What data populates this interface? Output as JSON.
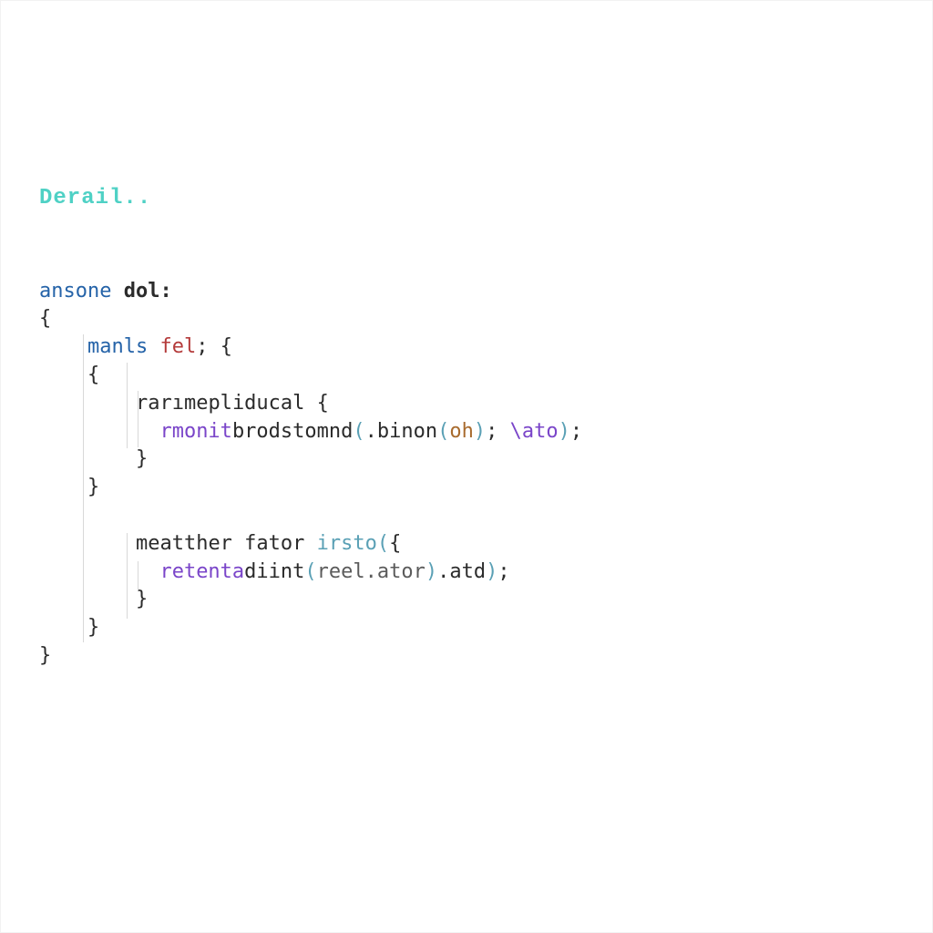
{
  "title": "Derail..",
  "code": {
    "l1_kw": "ansone",
    "l1_rest": " dol:",
    "l2": "{",
    "l3_kw": "manls",
    "l3_fn": " fel",
    "l3_rest": "; {",
    "l4": "{",
    "l5_a": "rarımepl",
    "l5_b": "iducal {",
    "l6_fn": "rmonit",
    "l6_b": "brodstomnd",
    "l6_p1": "(",
    "l6_c": ".binon",
    "l6_p2": "(",
    "l6_d": "oh",
    "l6_p3": ")",
    "l6_e": "; ",
    "l6_f": "\\ato",
    "l6_p4": ")",
    "l6_g": ";",
    "l7": "}",
    "l8": "}",
    "l9_a": "meatther fator ",
    "l9_b": "irsto",
    "l9_p1": "(",
    "l9_c": "{",
    "l10_fn": "retenta",
    "l10_b": "diint",
    "l10_p1": "(",
    "l10_c": "reel.ator",
    "l10_p2": ")",
    "l10_d": ".atd",
    "l10_p3": ")",
    "l10_e": ";",
    "l11": "}",
    "l12": "}",
    "l13": "}"
  }
}
